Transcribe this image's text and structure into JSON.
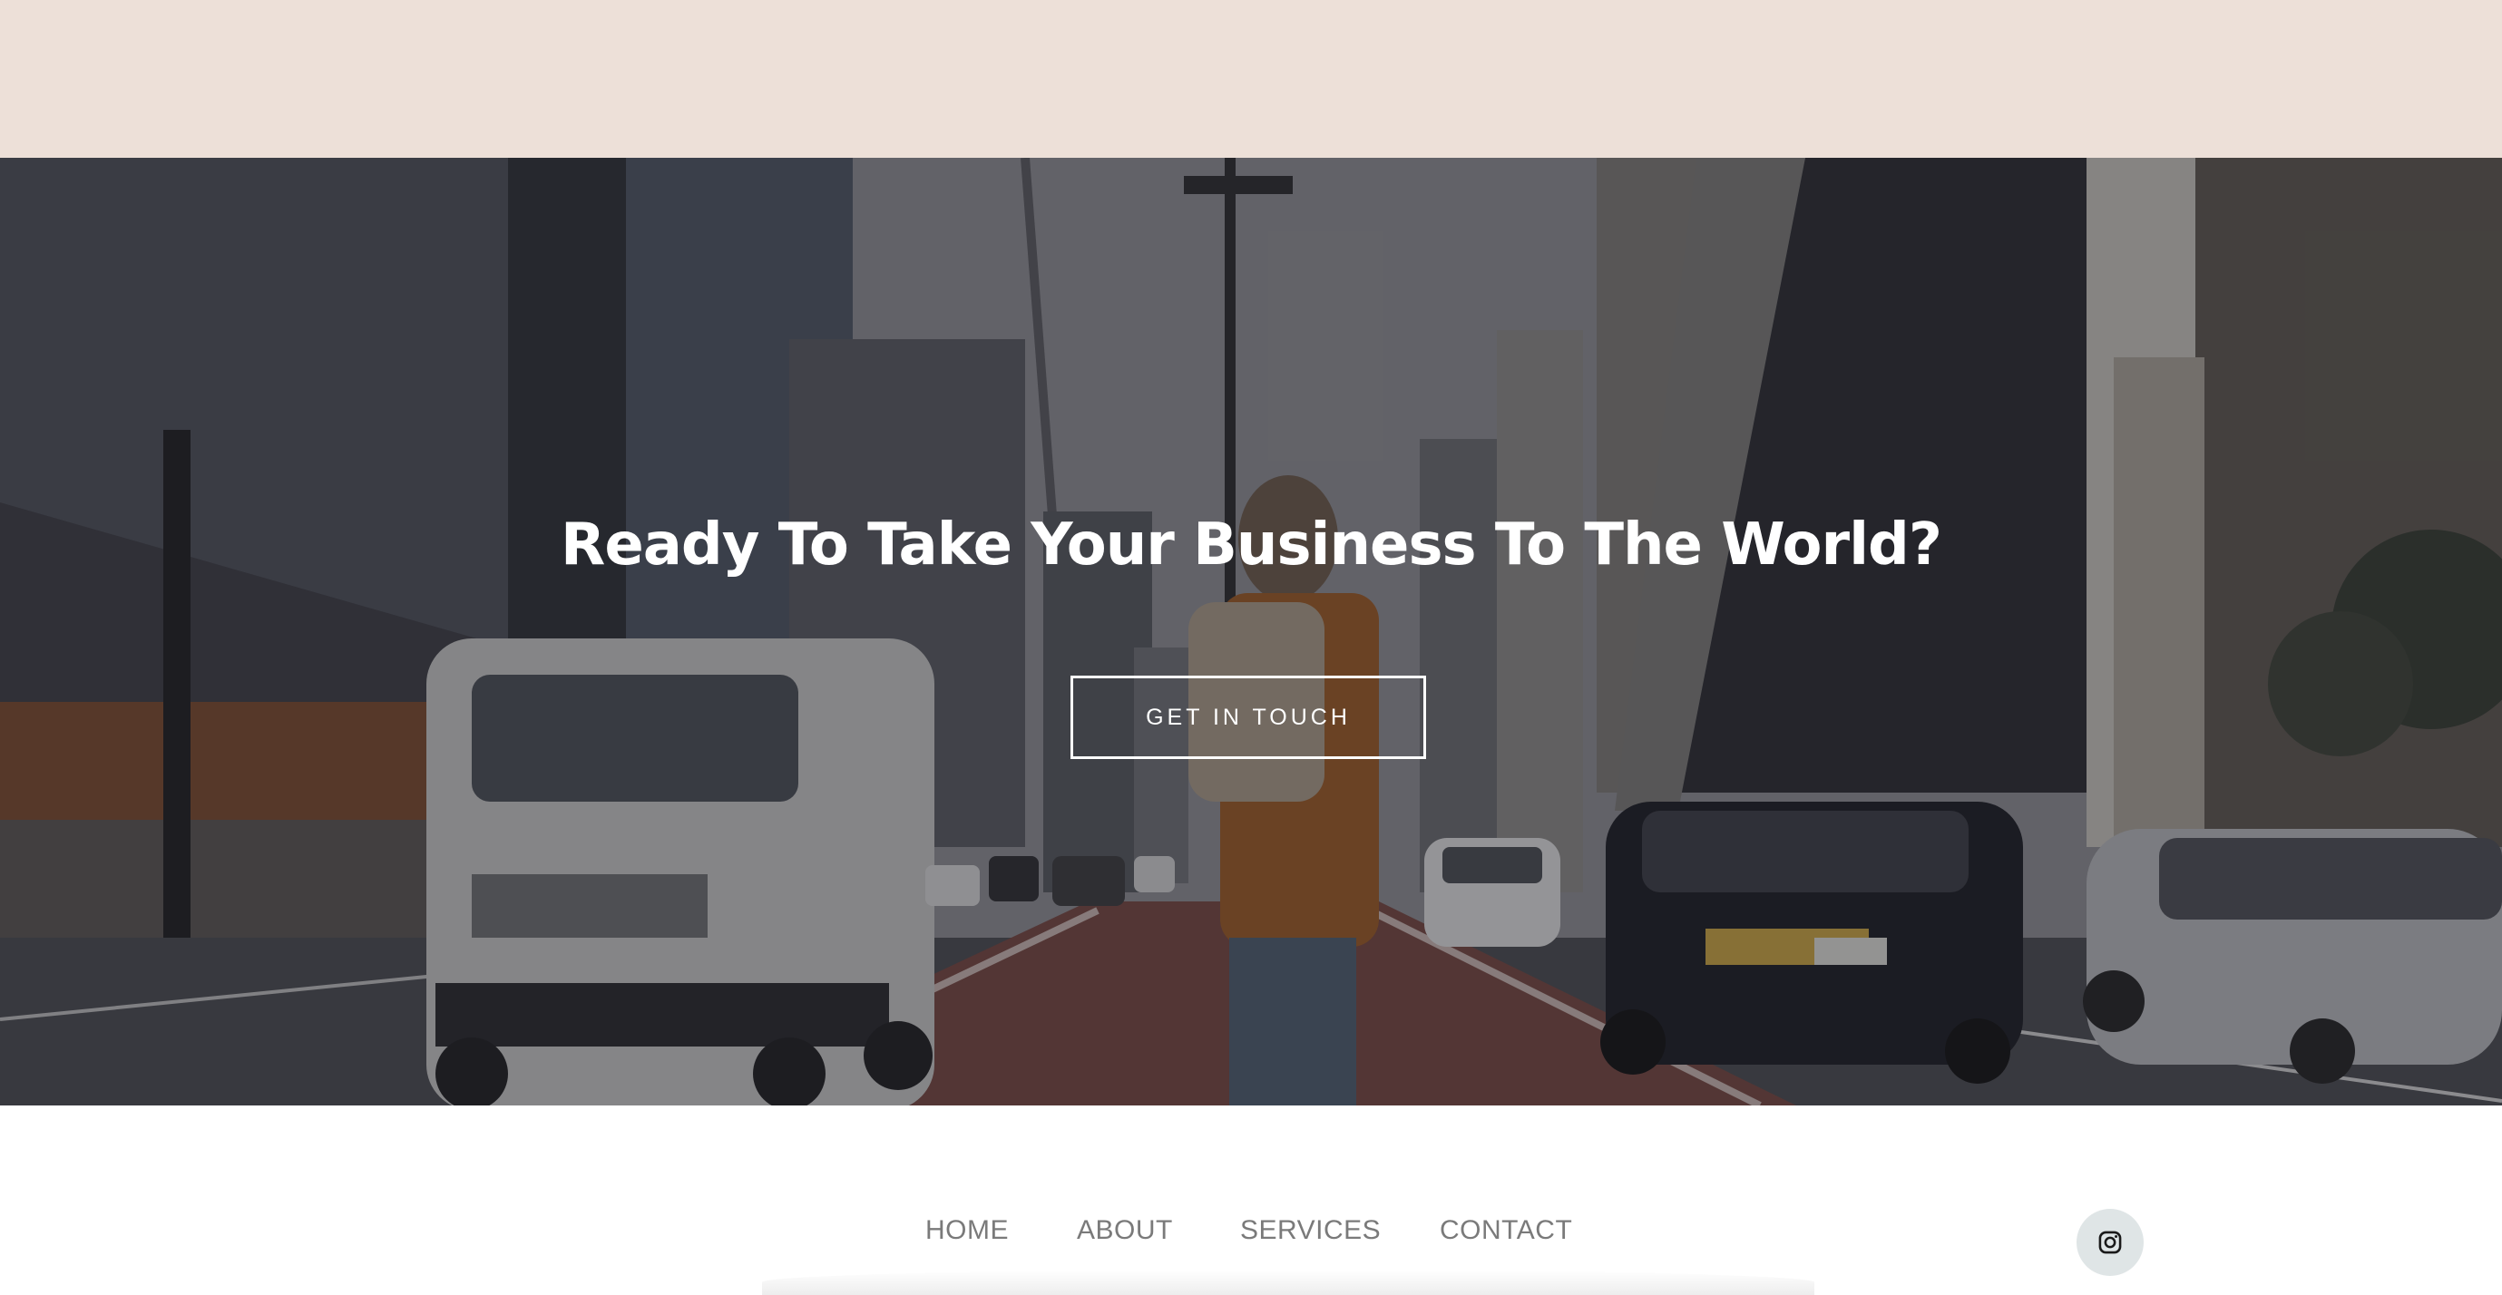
{
  "hero": {
    "heading": "Ready To Take Your Business To The World?",
    "cta_label": "GET IN TOUCH"
  },
  "footer": {
    "nav": [
      "HOME",
      "ABOUT",
      "SERVICES",
      "CONTACT"
    ],
    "social_icon": "instagram-icon"
  },
  "colors": {
    "top_band": "#ede0d8",
    "nav_text": "#7a7a7a",
    "social_bg": "#dfe5e6"
  }
}
